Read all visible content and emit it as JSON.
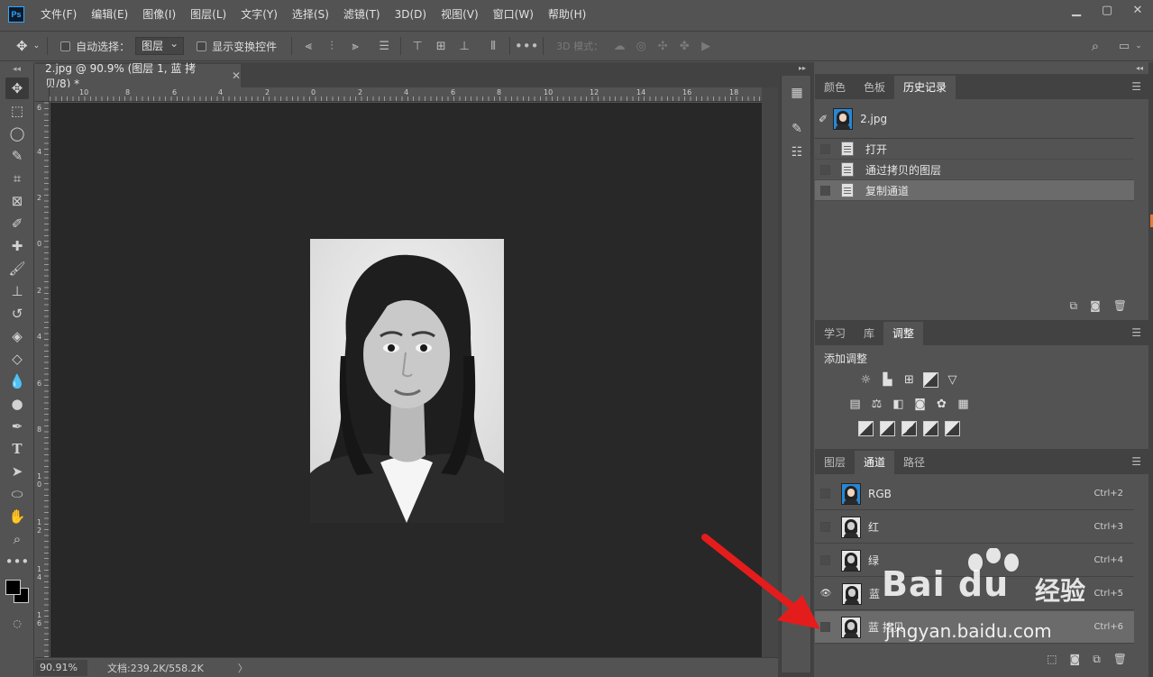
{
  "app": {
    "logo": "Ps",
    "menu": [
      "文件(F)",
      "编辑(E)",
      "图像(I)",
      "图层(L)",
      "文字(Y)",
      "选择(S)",
      "滤镜(T)",
      "3D(D)",
      "视图(V)",
      "窗口(W)",
      "帮助(H)"
    ],
    "window_controls": [
      "minimize-icon",
      "restore-icon",
      "close-icon"
    ]
  },
  "options": {
    "auto_select_label": "自动选择：",
    "auto_select_target": "图层",
    "show_transform_label": "显示变换控件",
    "mode_3d_label": "3D 模式："
  },
  "document": {
    "tab_title": "2.jpg @ 90.9% (图层 1, 蓝 拷贝/8) *",
    "zoom": "90.91%",
    "doc_info": "文档:239.2K/558.2K",
    "status_arrow": "〉"
  },
  "rulers": {
    "h_labels": [
      "10",
      "8",
      "6",
      "4",
      "2",
      "0",
      "2",
      "4",
      "6",
      "8",
      "10",
      "12",
      "14",
      "16",
      "18"
    ],
    "v_labels": [
      "6",
      "4",
      "2",
      "0",
      "2",
      "4",
      "6",
      "8",
      "1 0",
      "1 2",
      "1 4",
      "1 6"
    ]
  },
  "history_panel": {
    "tabs": [
      "颜色",
      "色板",
      "历史记录"
    ],
    "active_tab": "历史记录",
    "snapshot_label": "2.jpg",
    "items": [
      {
        "label": "打开",
        "selected": false
      },
      {
        "label": "通过拷贝的图层",
        "selected": false
      },
      {
        "label": "复制通道",
        "selected": true
      }
    ]
  },
  "adjust_panel": {
    "tabs": [
      "学习",
      "库",
      "调整"
    ],
    "active_tab": "调整",
    "title": "添加调整"
  },
  "channels_panel": {
    "tabs": [
      "图层",
      "通道",
      "路径"
    ],
    "active_tab": "通道",
    "channels": [
      {
        "name": "RGB",
        "shortcut": "Ctrl+2",
        "visible": false,
        "selected": false
      },
      {
        "name": "红",
        "shortcut": "Ctrl+3",
        "visible": false,
        "selected": false
      },
      {
        "name": "绿",
        "shortcut": "Ctrl+4",
        "visible": false,
        "selected": false
      },
      {
        "name": "蓝",
        "shortcut": "Ctrl+5",
        "visible": true,
        "selected": false
      },
      {
        "name": "蓝 拷贝",
        "shortcut": "Ctrl+6",
        "visible": false,
        "selected": true
      }
    ]
  },
  "watermark": {
    "brand": "Bai du",
    "product": "经验",
    "url": "jingyan.baidu.com"
  },
  "colors": {
    "arrow": "#e51c1c",
    "accent": "#31a8ff",
    "edge_mark": "#e8793b"
  }
}
